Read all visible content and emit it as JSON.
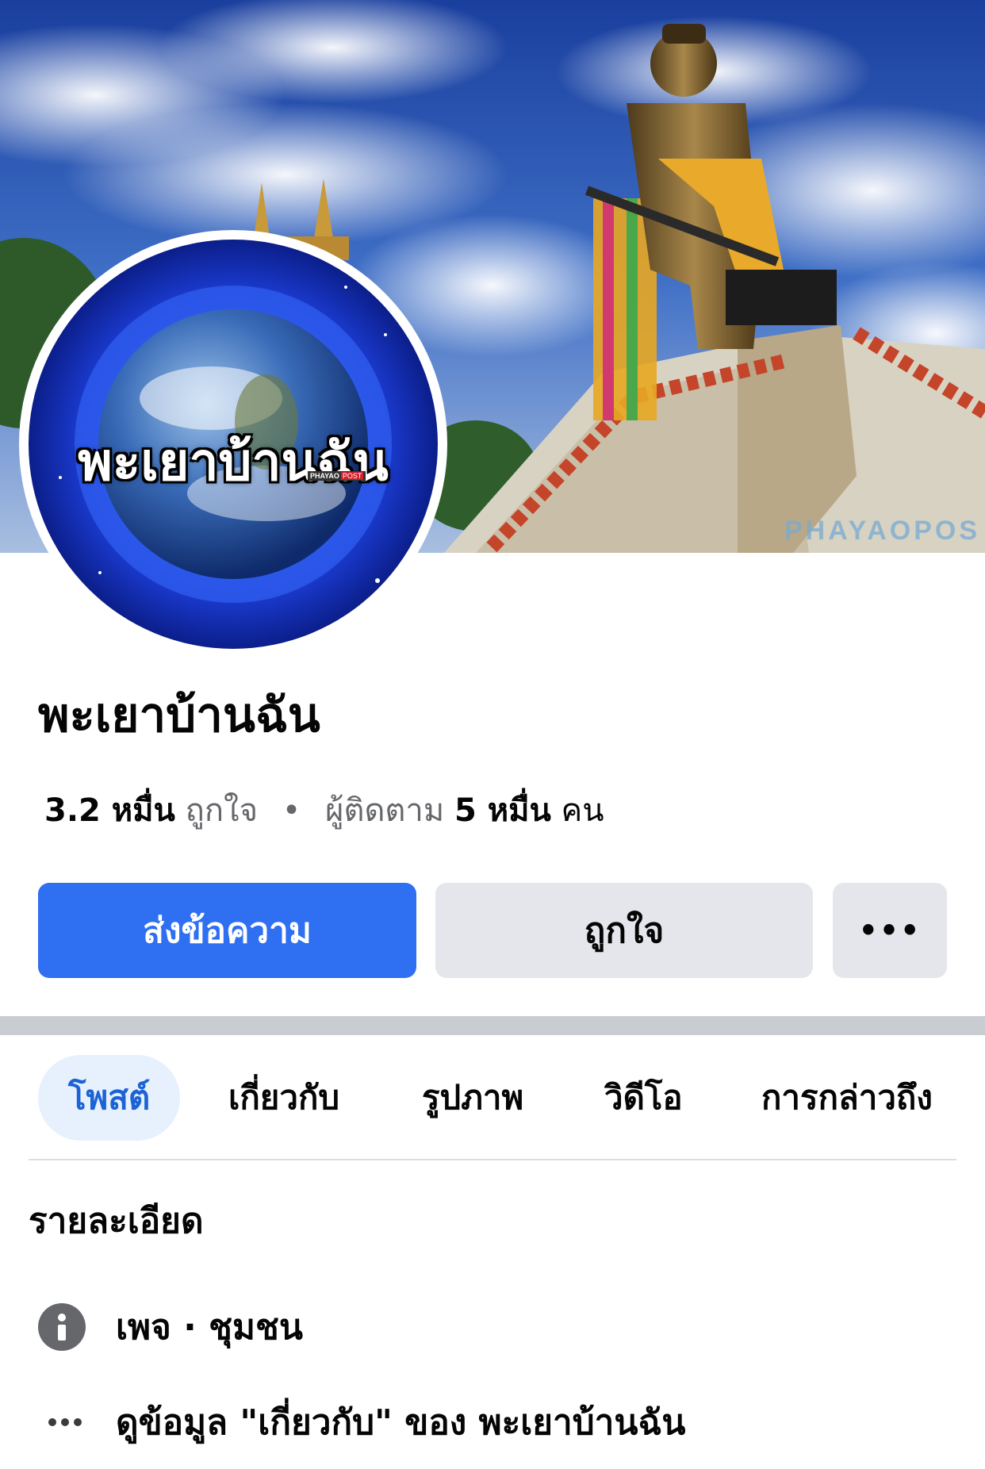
{
  "cover": {
    "watermark": "PHAYAOPOS"
  },
  "avatar": {
    "text": "พะเยาบ้านฉัน",
    "badge_left": "PHAYAO",
    "badge_right": "POST"
  },
  "page": {
    "name": "พะเยาบ้านฉัน"
  },
  "stats": {
    "likes_num": "3.2 หมื่น",
    "likes_label": "ถูกใจ",
    "separator": "•",
    "followers_label": "ผู้ติดตาม",
    "followers_num": "5 หมื่น",
    "followers_unit": "คน"
  },
  "actions": {
    "message": "ส่งข้อความ",
    "like": "ถูกใจ",
    "more": "•••"
  },
  "tabs": [
    {
      "label": "โพสต์",
      "active": true
    },
    {
      "label": "เกี่ยวกับ"
    },
    {
      "label": "รูปภาพ"
    },
    {
      "label": "วิดีโอ"
    },
    {
      "label": "การกล่าวถึง"
    }
  ],
  "details": {
    "title": "รายละเอียด",
    "category": "เพจ · ชุมชน",
    "see_about": "ดูข้อมูล \"เกี่ยวกับ\" ของ พะเยาบ้านฉัน"
  },
  "colors": {
    "primary": "#2f6ff2",
    "secondary_button": "#e4e6eb",
    "active_tab_bg": "#e7f0fd",
    "active_tab_text": "#1b63d6",
    "muted_text": "#65676b"
  }
}
